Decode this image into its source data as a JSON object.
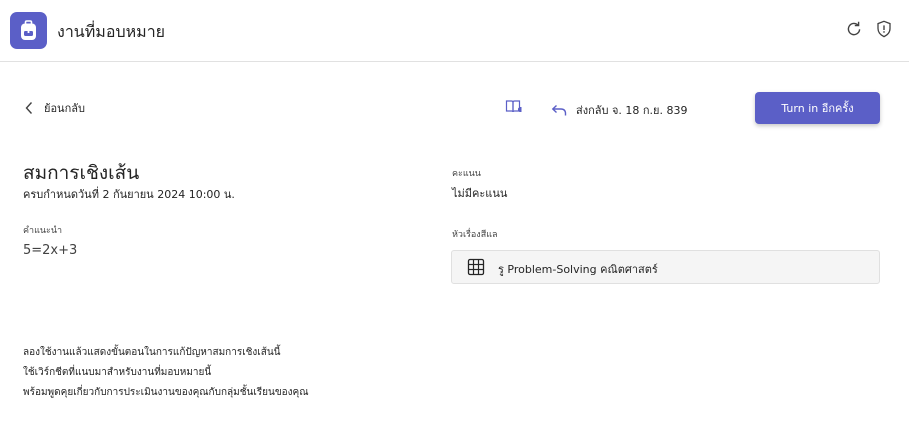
{
  "header": {
    "title": "งานที่มอบหมาย",
    "icons": [
      "backpack-icon",
      "refresh-icon",
      "shield-icon"
    ]
  },
  "toolbar": {
    "back_label": "ย้อนกลับ",
    "reader_icon": "immersive-reader-icon",
    "returned_text": "ส่งกลับ จ. 18 ก.ย. 839",
    "turn_in_label": "Turn in อีกครั้ง"
  },
  "assignment": {
    "title": "สมการเชิงเส้น",
    "due": "ครบกำหนดวันที่ 2 กันยายน 2024 10:00 น.",
    "instructions_label": "คำแนะนำ",
    "instructions_text": "5=2x+3"
  },
  "side": {
    "points_label": "คะแนน",
    "points_value": "ไม่มีคะแนน",
    "rubric_label": "หัวเรื่องสีแล",
    "rubric_name": "รู Problem-Solving คณิตศาสตร์"
  },
  "body": {
    "lines": [
      "ลองใช้งานแล้วแสดงขั้นตอนในการแก้ปัญหาสมการเชิงเส้นนี้",
      "ใช้เวิร์กชีตที่แนบมาสำหรับงานที่มอบหมายนี้",
      "พร้อมพูดคุยเกี่ยวกับการประเมินงานของคุณกับกลุ่มชั้นเรียนของคุณ"
    ]
  },
  "colors": {
    "accent": "#5b5fc7",
    "divider": "#e1e1e1",
    "card_bg": "#f5f5f5"
  }
}
